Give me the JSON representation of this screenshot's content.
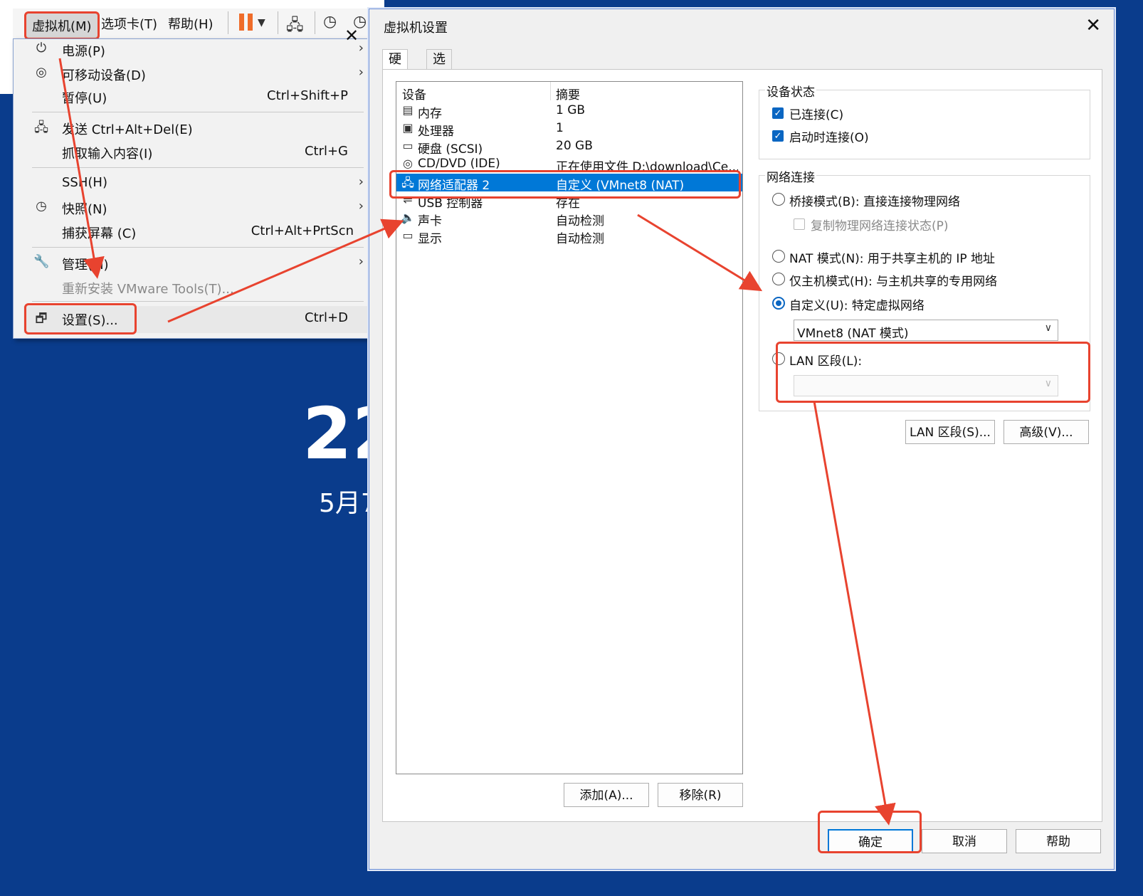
{
  "background": {
    "clock": "22",
    "date": "5月7"
  },
  "menubar": {
    "vm": "虚拟机(M)",
    "tabs": "选项卡(T)",
    "help": "帮助(H)"
  },
  "menu": {
    "items": [
      {
        "label": "电源(P)",
        "shortcut": "",
        "arrow": "›"
      },
      {
        "label": "可移动设备(D)",
        "shortcut": "",
        "arrow": "›"
      },
      {
        "label": "暂停(U)",
        "shortcut": "Ctrl+Shift+P",
        "arrow": ""
      },
      {
        "label": "发送 Ctrl+Alt+Del(E)",
        "shortcut": "",
        "arrow": ""
      },
      {
        "label": "抓取输入内容(I)",
        "shortcut": "Ctrl+G",
        "arrow": ""
      },
      {
        "label": "SSH(H)",
        "shortcut": "",
        "arrow": "›"
      },
      {
        "label": "快照(N)",
        "shortcut": "",
        "arrow": "›"
      },
      {
        "label": "捕获屏幕 (C)",
        "shortcut": "Ctrl+Alt+PrtScn",
        "arrow": ""
      },
      {
        "label": "管理(M)",
        "shortcut": "",
        "arrow": "›"
      },
      {
        "label": "重新安装 VMware Tools(T)...",
        "shortcut": "",
        "arrow": ""
      },
      {
        "label": "设置(S)...",
        "shortcut": "Ctrl+D",
        "arrow": ""
      }
    ]
  },
  "dialog": {
    "title": "虚拟机设置",
    "tabs": [
      "硬件",
      "选项"
    ],
    "device_list": {
      "headers": [
        "设备",
        "摘要"
      ],
      "rows": [
        {
          "name": "内存",
          "summary": "1 GB"
        },
        {
          "name": "处理器",
          "summary": "1"
        },
        {
          "name": "硬盘 (SCSI)",
          "summary": "20 GB"
        },
        {
          "name": "CD/DVD (IDE)",
          "summary": "正在使用文件 D:\\download\\Ce..."
        },
        {
          "name": "网络适配器 2",
          "summary": "自定义 (VMnet8 (NAT)"
        },
        {
          "name": "USB 控制器",
          "summary": "存在"
        },
        {
          "name": "声卡",
          "summary": "自动检测"
        },
        {
          "name": "显示",
          "summary": "自动检测"
        }
      ]
    },
    "add_button": "添加(A)...",
    "remove_button": "移除(R)",
    "device_status": {
      "title": "设备状态",
      "connected": "已连接(C)",
      "connect_at_power_on": "启动时连接(O)"
    },
    "network": {
      "title": "网络连接",
      "bridged": "桥接模式(B): 直接连接物理网络",
      "replicate": "复制物理网络连接状态(P)",
      "nat": "NAT 模式(N): 用于共享主机的 IP 地址",
      "host_only": "仅主机模式(H): 与主机共享的专用网络",
      "custom": "自定义(U): 特定虚拟网络",
      "custom_value": "VMnet8 (NAT 模式)",
      "lan": "LAN 区段(L):",
      "lan_value": ""
    },
    "lan_segments_button": "LAN 区段(S)...",
    "advanced_button": "高级(V)...",
    "ok_button": "确定",
    "cancel_button": "取消",
    "help_button": "帮助"
  },
  "colors": {
    "accent": "#0078d7",
    "annotation": "#e8432f",
    "desktop": "#0a3c8c"
  }
}
